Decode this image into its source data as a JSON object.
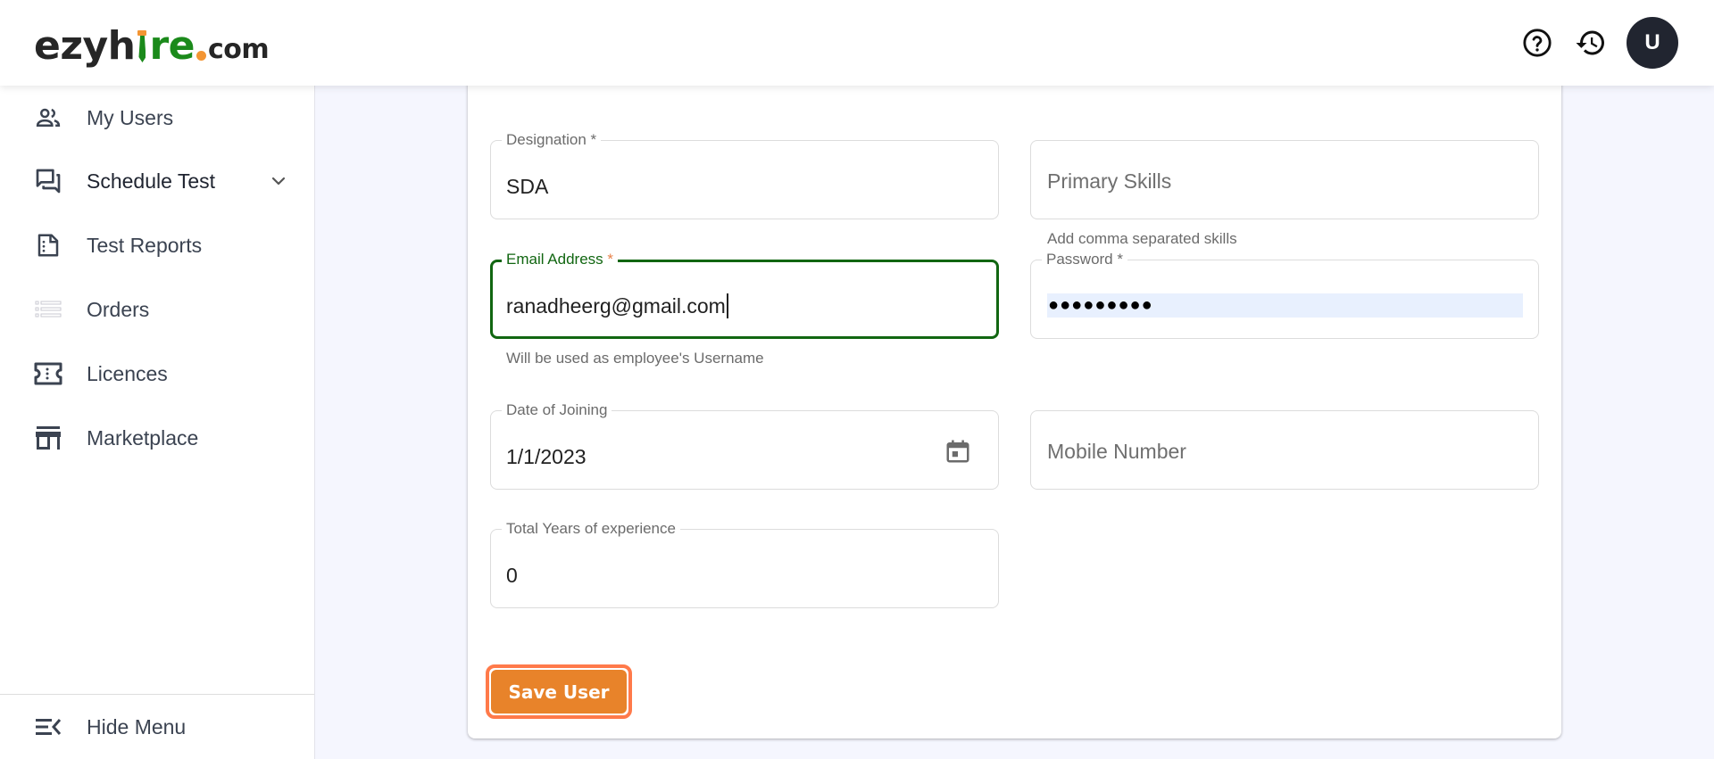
{
  "brand": {
    "logo_main": "ezyh",
    "logo_tie_letter": "i",
    "logo_green": "re",
    "logo_suffix": "com",
    "colors": {
      "green": "#1b8a1b",
      "orange": "#f39533",
      "dark": "#262626"
    }
  },
  "header": {
    "help_icon": "help-circle-icon",
    "history_icon": "history-icon",
    "avatar_initial": "U",
    "avatar_color": "#212530"
  },
  "sidebar": {
    "items": [
      {
        "label": "My Users",
        "icon": "users-icon"
      },
      {
        "label": "Schedule Test",
        "icon": "chat-bubbles-icon",
        "has_submenu": true,
        "expanded": false
      },
      {
        "label": "Test Reports",
        "icon": "report-icon"
      },
      {
        "label": "Orders",
        "icon": "list-icon"
      },
      {
        "label": "Licences",
        "icon": "ticket-icon"
      },
      {
        "label": "Marketplace",
        "icon": "store-icon"
      }
    ],
    "hide_menu_label": "Hide Menu",
    "hide_menu_icon": "menu-collapse-icon"
  },
  "form": {
    "designation": {
      "label": "Designation",
      "required_mark": "*",
      "value": "SDA"
    },
    "primary_skills": {
      "placeholder": "Primary Skills",
      "helper": "Add comma separated skills"
    },
    "email": {
      "label": "Email Address",
      "required_mark": "*",
      "value": "ranadheerg@gmail.com",
      "helper": "Will be used as employee's Username",
      "focused": true,
      "focus_color": "#116611"
    },
    "password": {
      "label": "Password",
      "required_mark": "*",
      "masked_value": "●●●●●●●●●",
      "autofill_bg": "#e8f0fe"
    },
    "date_of_joining": {
      "label": "Date of Joining",
      "value": "1/1/2023",
      "icon": "calendar-icon"
    },
    "mobile_number": {
      "placeholder": "Mobile Number"
    },
    "total_experience": {
      "label": "Total Years of experience",
      "value": "0"
    },
    "save_button": {
      "label": "Save User",
      "color": "#e8832a",
      "outline_color": "#ff7a4a"
    }
  }
}
